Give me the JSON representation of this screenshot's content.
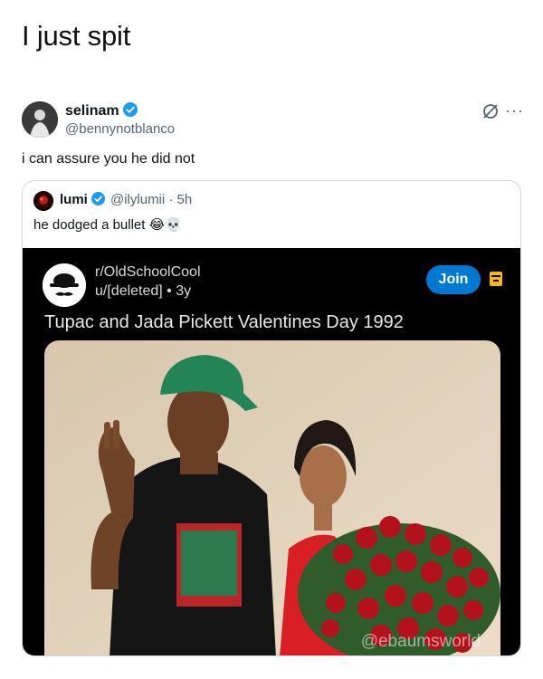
{
  "caption": "I just spit",
  "tweet": {
    "author_name": "selinam",
    "author_handle": "@bennynotblanco",
    "text": "i can assure you he did not",
    "more_icon": "more-icon",
    "quote": {
      "author_name": "lumi",
      "meta": "@ilylumii · 5h",
      "text": "he dodged a bullet 😂💀",
      "reddit": {
        "subreddit": "r/OldSchoolCool",
        "user_time": "u/[deleted] • 3y",
        "join_label": "Join",
        "title": "Tupac and Jada Pickett Valentines Day 1992",
        "watermark": "@ebaumsworld"
      }
    }
  },
  "colors": {
    "verified_blue": "#1d9bf0",
    "reddit_join": "#0079d3",
    "reddit_save": "#f6b90b"
  }
}
